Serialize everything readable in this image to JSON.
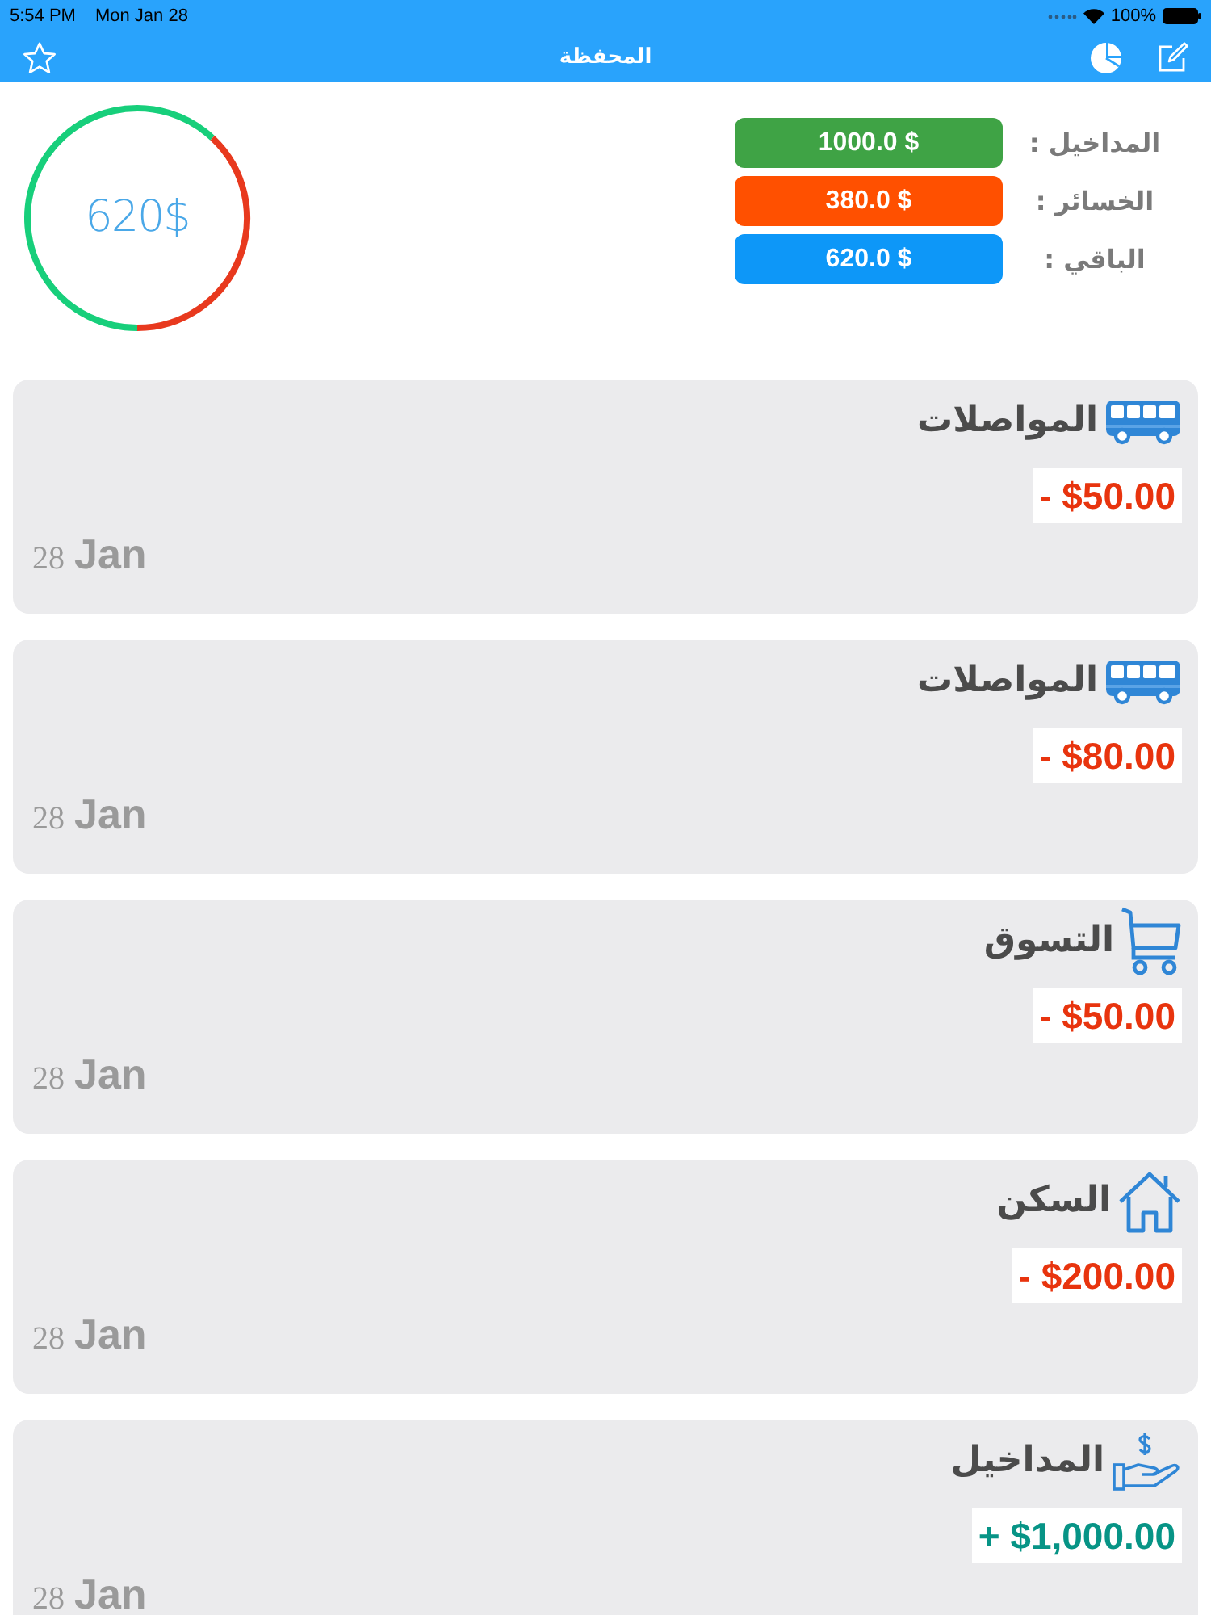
{
  "status_bar": {
    "time": "5:54 PM",
    "date": "Mon Jan 28",
    "battery": "100%"
  },
  "nav_bar": {
    "title": "المحفظة"
  },
  "balance_ring": {
    "text": "620$"
  },
  "summary": [
    {
      "label": "المداخيل :",
      "value": "1000.0 $",
      "color": "#3fa345"
    },
    {
      "label": "الخسائر :",
      "value": "380.0 $",
      "color": "#ff5000"
    },
    {
      "label": "الباقي :",
      "value": "620.0 $",
      "color": "#0d97f8"
    }
  ],
  "transactions": [
    {
      "kind": "transport",
      "title": "المواصلات",
      "amount": "- $50.00",
      "day": "28",
      "month": "Jan"
    },
    {
      "kind": "transport",
      "title": "المواصلات",
      "amount": "- $80.00",
      "day": "28",
      "month": "Jan"
    },
    {
      "kind": "shopping",
      "title": "التسوق",
      "amount": "- $50.00",
      "day": "28",
      "month": "Jan"
    },
    {
      "kind": "housing",
      "title": "السكن",
      "amount": "- $200.00",
      "day": "28",
      "month": "Jan"
    },
    {
      "kind": "income",
      "title": "المداخيل",
      "amount": "+ $1,000.00",
      "day": "28",
      "month": "Jan"
    }
  ]
}
